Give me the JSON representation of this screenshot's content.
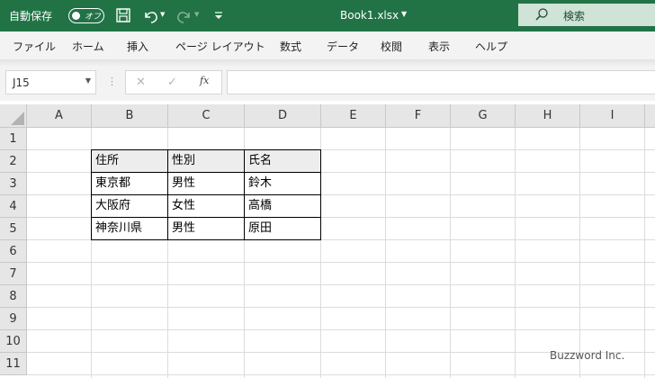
{
  "titlebar": {
    "autosave_label": "自動保存",
    "autosave_state": "オフ",
    "file_name": "Book1.xlsx",
    "search_placeholder": "検索",
    "bg_color": "#217346"
  },
  "menu": {
    "tabs": [
      "ファイル",
      "ホーム",
      "挿入",
      "ページ レイアウト",
      "数式",
      "データ",
      "校閲",
      "表示",
      "ヘルプ"
    ]
  },
  "formula_bar": {
    "name_box": "J15",
    "fx_label": "fx",
    "formula": ""
  },
  "sheet": {
    "columns": [
      "A",
      "B",
      "C",
      "D",
      "E",
      "F",
      "G",
      "H",
      "I"
    ],
    "rows": [
      "1",
      "2",
      "3",
      "4",
      "5",
      "6",
      "7",
      "8",
      "9",
      "10",
      "11"
    ],
    "table": {
      "header": [
        "住所",
        "性別",
        "氏名"
      ],
      "rows": [
        [
          "東京都",
          "男性",
          "鈴木"
        ],
        [
          "大阪府",
          "女性",
          "高橋"
        ],
        [
          "神奈川県",
          "男性",
          "原田"
        ]
      ]
    }
  },
  "watermark": "Buzzword Inc."
}
